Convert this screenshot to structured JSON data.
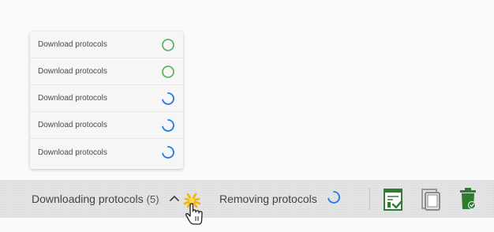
{
  "popup": {
    "items": [
      {
        "label": "Download protocols",
        "status": "done",
        "icon": "circle-done-icon"
      },
      {
        "label": "Download protocols",
        "status": "done",
        "icon": "circle-done-icon"
      },
      {
        "label": "Download protocols",
        "status": "loading",
        "icon": "spinner-icon"
      },
      {
        "label": "Download protocols",
        "status": "loading",
        "icon": "spinner-icon"
      },
      {
        "label": "Download protocols",
        "status": "loading",
        "icon": "spinner-icon"
      }
    ]
  },
  "status_bar": {
    "downloading_label": "Downloading protocols",
    "downloading_count": "(5)",
    "removing_label": "Removing protocols"
  },
  "colors": {
    "done": "#4caf50",
    "loading": "#1e78e6",
    "toolbar_green": "#2e7d32",
    "toolbar_gray": "#8a8a8a"
  },
  "toolbar": {
    "icons": [
      "checklist-doc-icon",
      "tablet-icon",
      "trash-icon"
    ]
  }
}
